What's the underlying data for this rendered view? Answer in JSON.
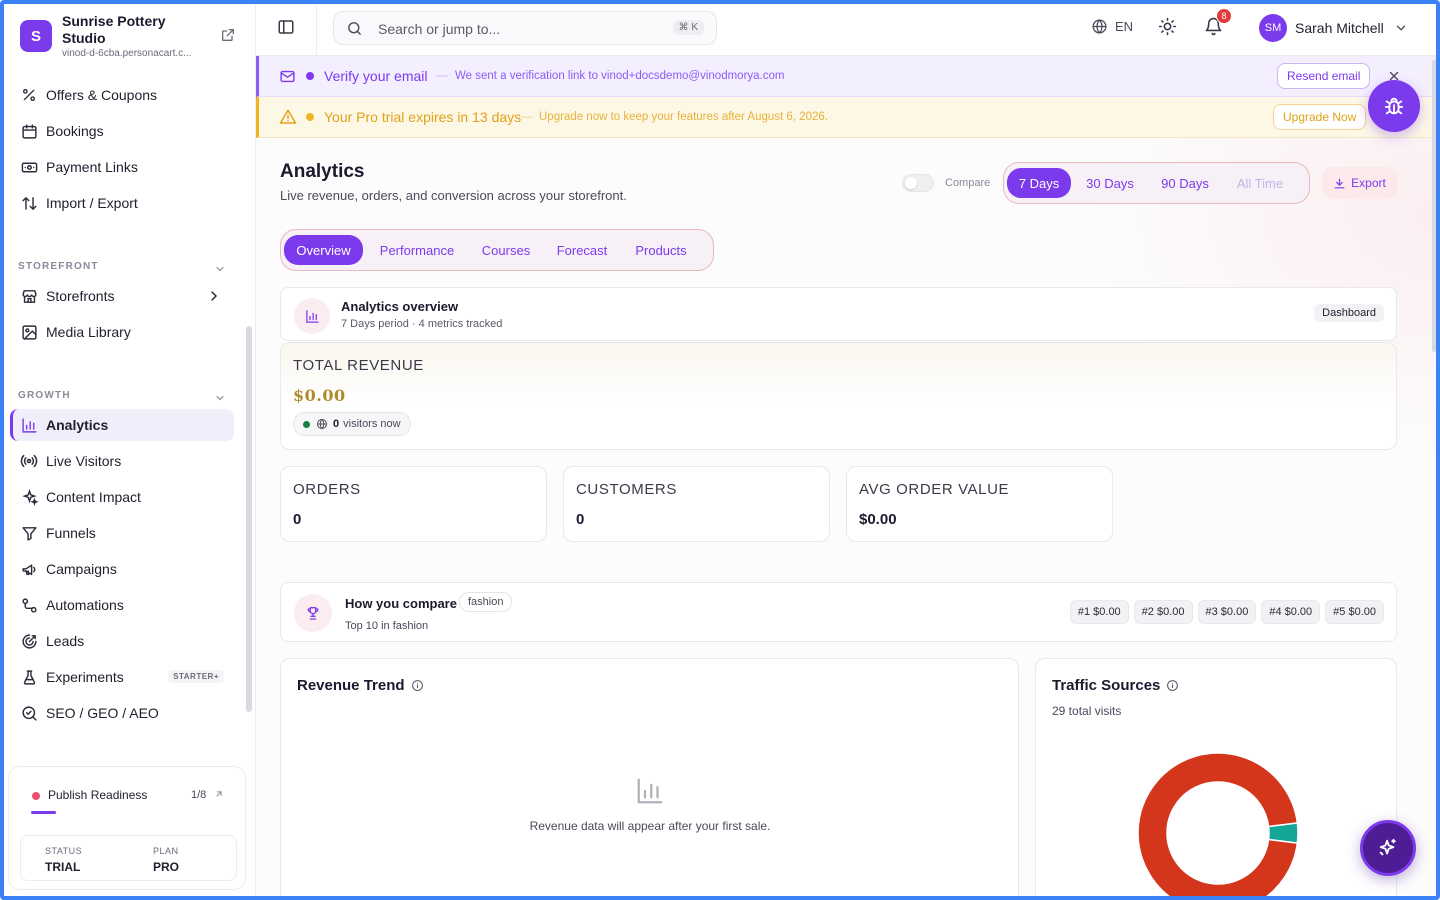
{
  "brand": {
    "initial": "S",
    "name": "Sunrise Pottery Studio",
    "url": "vinod-d-6cba.personacart.c..."
  },
  "sidebar": {
    "top_items": [
      {
        "label": "Offers & Coupons",
        "icon": "percent-icon"
      },
      {
        "label": "Bookings",
        "icon": "calendar-icon"
      },
      {
        "label": "Payment Links",
        "icon": "payment-link-icon"
      },
      {
        "label": "Import / Export",
        "icon": "import-export-icon"
      }
    ],
    "sections": [
      {
        "title": "STOREFRONT",
        "items": [
          {
            "label": "Storefronts",
            "icon": "store-icon"
          },
          {
            "label": "Media Library",
            "icon": "image-icon"
          }
        ]
      },
      {
        "title": "GROWTH",
        "items": [
          {
            "label": "Analytics",
            "icon": "bar-chart-icon",
            "active": true
          },
          {
            "label": "Live Visitors",
            "icon": "broadcast-icon"
          },
          {
            "label": "Content Impact",
            "icon": "sparkle-icon"
          },
          {
            "label": "Funnels",
            "icon": "funnel-icon"
          },
          {
            "label": "Campaigns",
            "icon": "megaphone-icon"
          },
          {
            "label": "Automations",
            "icon": "workflow-icon"
          },
          {
            "label": "Leads",
            "icon": "target-icon"
          },
          {
            "label": "Experiments",
            "icon": "flask-icon",
            "badge": "STARTER+"
          },
          {
            "label": "SEO / GEO / AEO",
            "icon": "search-icon"
          }
        ]
      }
    ],
    "readiness": {
      "title": "Publish Readiness",
      "count": "1/8",
      "progress": 0.125,
      "status_label": "STATUS",
      "status_value": "TRIAL",
      "plan_label": "PLAN",
      "plan_value": "PRO"
    }
  },
  "topbar": {
    "search_placeholder": "Search or jump to...",
    "search_shortcut": "⌘ K",
    "language": "EN",
    "notifications_count": "8",
    "user_initials": "SM",
    "user_name": "Sarah Mitchell"
  },
  "banners": {
    "verify": {
      "title": "Verify your email",
      "message": "We sent a verification link to vinod+docsdemo@vinodmorya.com",
      "button": "Resend email",
      "separator": "—"
    },
    "trial": {
      "title": "Your Pro trial expires in 13 days",
      "message": "Upgrade now to keep your features after August 6, 2026.",
      "button": "Upgrade Now",
      "separator": "—"
    }
  },
  "page": {
    "title": "Analytics",
    "subtitle": "Live revenue, orders, and conversion across your storefront.",
    "compare_label": "Compare",
    "ranges": [
      "7 Days",
      "30 Days",
      "90 Days",
      "All Time"
    ],
    "active_range": "7 Days",
    "export_label": "Export",
    "tabs": [
      "Overview",
      "Performance",
      "Courses",
      "Forecast",
      "Products"
    ],
    "active_tab": "Overview"
  },
  "overview": {
    "title": "Analytics overview",
    "subtitle": "7 Days period · 4 metrics tracked",
    "badge": "Dashboard"
  },
  "revenue": {
    "label": "TOTAL REVENUE",
    "value": "$0.00",
    "visitors_count": "0",
    "visitors_label": "visitors now"
  },
  "kpis": [
    {
      "label": "ORDERS",
      "value": "0"
    },
    {
      "label": "CUSTOMERS",
      "value": "0"
    },
    {
      "label": "AVG ORDER VALUE",
      "value": "$0.00"
    }
  ],
  "compare_card": {
    "title": "How you compare",
    "tag": "fashion",
    "subtitle": "Top 10 in fashion",
    "ranks": [
      "#1  $0.00",
      "#2  $0.00",
      "#3  $0.00",
      "#4  $0.00",
      "#5  $0.00"
    ]
  },
  "revenue_trend": {
    "title": "Revenue Trend",
    "empty_text": "Revenue data will appear after your first sale."
  },
  "traffic": {
    "title": "Traffic Sources",
    "subtitle": "29 total visits",
    "colors": {
      "main": "#d4361c",
      "secondary": "#14a699"
    },
    "slices": [
      {
        "label": "",
        "share": 0.96,
        "color": "#d4361c"
      },
      {
        "label": "",
        "share": 0.04,
        "color": "#14a699"
      }
    ]
  },
  "colors": {
    "accent": "#7c3aed",
    "warning": "#f0b429",
    "danger": "#e23b3b"
  }
}
